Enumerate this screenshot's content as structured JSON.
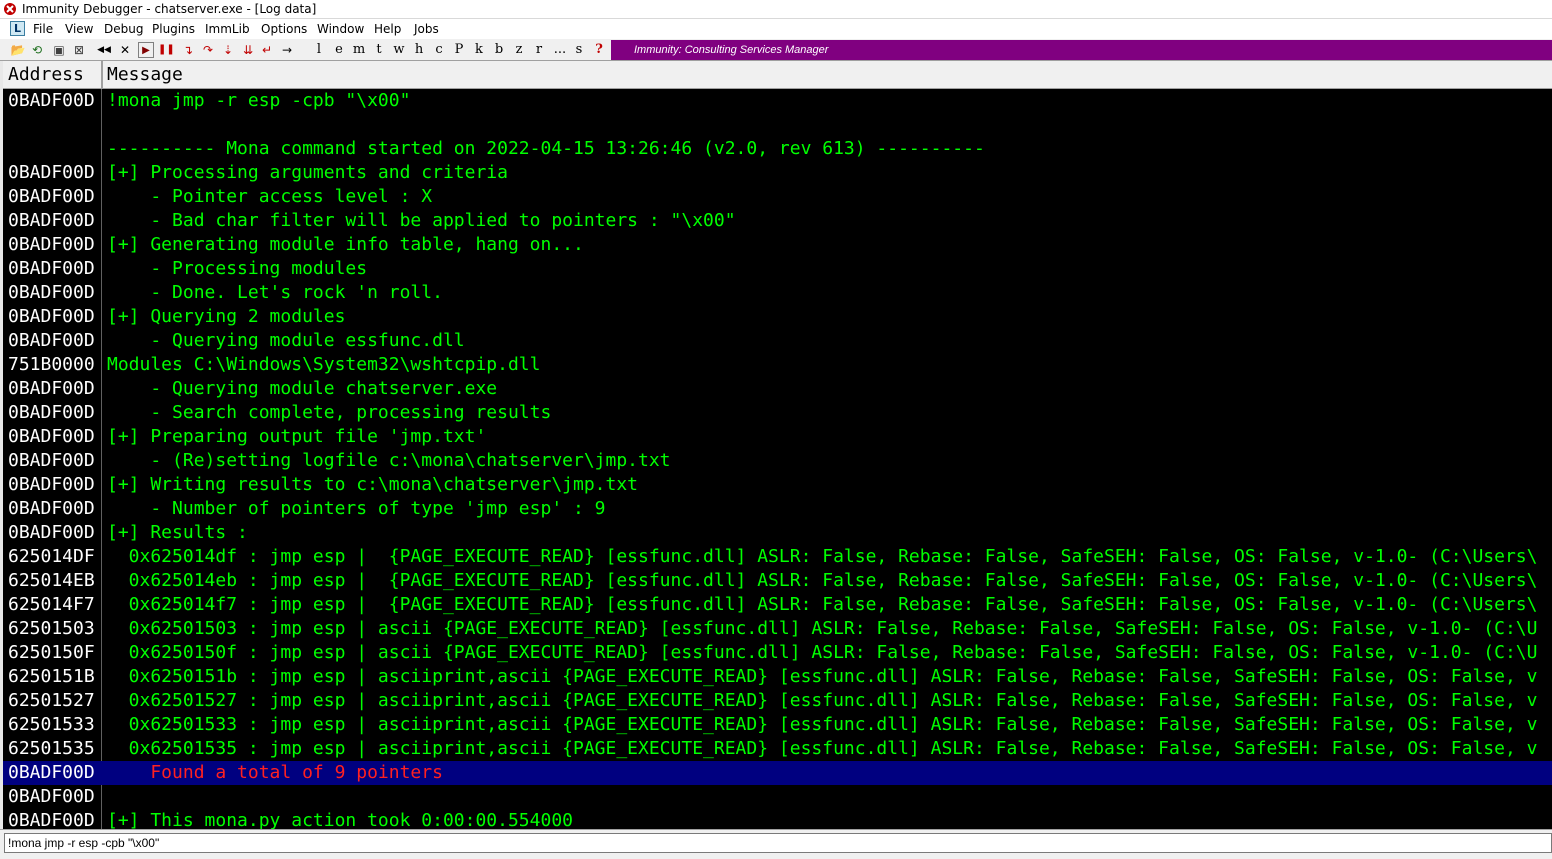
{
  "window": {
    "title": "Immunity Debugger - chatserver.exe - [Log data]"
  },
  "menu": [
    {
      "label": "File"
    },
    {
      "label": "View"
    },
    {
      "label": "Debug"
    },
    {
      "label": "Plugins"
    },
    {
      "label": "ImmLib"
    },
    {
      "label": "Options"
    },
    {
      "label": "Window"
    },
    {
      "label": "Help"
    },
    {
      "label": "Jobs"
    }
  ],
  "menu_icon_letter": "L",
  "toolbar": {
    "buttons": [
      {
        "name": "open-icon",
        "glyph": "📂"
      },
      {
        "name": "restart-icon",
        "glyph": "⟲"
      },
      {
        "name": "close-program-icon",
        "glyph": "▣"
      },
      {
        "name": "attach-icon",
        "glyph": "⊠"
      },
      {
        "name": "rewind-icon",
        "glyph": "◀◀"
      },
      {
        "name": "close-icon",
        "glyph": "✕"
      },
      {
        "name": "run-icon",
        "glyph": "▶"
      },
      {
        "name": "pause-icon",
        "glyph": "❚❚"
      },
      {
        "name": "step-into-icon",
        "glyph": "↴"
      },
      {
        "name": "step-over-icon",
        "glyph": "↷"
      },
      {
        "name": "trace-into-icon",
        "glyph": "⇣"
      },
      {
        "name": "trace-over-icon",
        "glyph": "⇊"
      },
      {
        "name": "execute-till-return-icon",
        "glyph": "↵"
      },
      {
        "name": "goto-icon",
        "glyph": "→"
      }
    ],
    "letters": [
      "l",
      "e",
      "m",
      "t",
      "w",
      "h",
      "c",
      "P",
      "k",
      "b",
      "z",
      "r",
      "...",
      "s",
      "?"
    ],
    "banner": "Immunity: Consulting Services Manager"
  },
  "log": {
    "header": {
      "address": "Address",
      "message": "Message"
    },
    "rows": [
      {
        "addr": "0BADF00D",
        "msg": "!mona jmp -r esp -cpb \"\\x00\""
      },
      {
        "addr": "",
        "msg": ""
      },
      {
        "addr": "",
        "msg": "---------- Mona command started on 2022-04-15 13:26:46 (v2.0, rev 613) ----------"
      },
      {
        "addr": "0BADF00D",
        "msg": "[+] Processing arguments and criteria"
      },
      {
        "addr": "0BADF00D",
        "msg": "    - Pointer access level : X"
      },
      {
        "addr": "0BADF00D",
        "msg": "    - Bad char filter will be applied to pointers : \"\\x00\""
      },
      {
        "addr": "0BADF00D",
        "msg": "[+] Generating module info table, hang on..."
      },
      {
        "addr": "0BADF00D",
        "msg": "    - Processing modules"
      },
      {
        "addr": "0BADF00D",
        "msg": "    - Done. Let's rock 'n roll."
      },
      {
        "addr": "0BADF00D",
        "msg": "[+] Querying 2 modules"
      },
      {
        "addr": "0BADF00D",
        "msg": "    - Querying module essfunc.dll"
      },
      {
        "addr": "751B0000",
        "msg": "Modules C:\\Windows\\System32\\wshtcpip.dll"
      },
      {
        "addr": "0BADF00D",
        "msg": "    - Querying module chatserver.exe"
      },
      {
        "addr": "0BADF00D",
        "msg": "    - Search complete, processing results"
      },
      {
        "addr": "0BADF00D",
        "msg": "[+] Preparing output file 'jmp.txt'"
      },
      {
        "addr": "0BADF00D",
        "msg": "    - (Re)setting logfile c:\\mona\\chatserver\\jmp.txt"
      },
      {
        "addr": "0BADF00D",
        "msg": "[+] Writing results to c:\\mona\\chatserver\\jmp.txt"
      },
      {
        "addr": "0BADF00D",
        "msg": "    - Number of pointers of type 'jmp esp' : 9"
      },
      {
        "addr": "0BADF00D",
        "msg": "[+] Results :"
      },
      {
        "addr": "625014DF",
        "msg": "  0x625014df : jmp esp |  {PAGE_EXECUTE_READ} [essfunc.dll] ASLR: False, Rebase: False, SafeSEH: False, OS: False, v-1.0- (C:\\Users\\"
      },
      {
        "addr": "625014EB",
        "msg": "  0x625014eb : jmp esp |  {PAGE_EXECUTE_READ} [essfunc.dll] ASLR: False, Rebase: False, SafeSEH: False, OS: False, v-1.0- (C:\\Users\\"
      },
      {
        "addr": "625014F7",
        "msg": "  0x625014f7 : jmp esp |  {PAGE_EXECUTE_READ} [essfunc.dll] ASLR: False, Rebase: False, SafeSEH: False, OS: False, v-1.0- (C:\\Users\\"
      },
      {
        "addr": "62501503",
        "msg": "  0x62501503 : jmp esp | ascii {PAGE_EXECUTE_READ} [essfunc.dll] ASLR: False, Rebase: False, SafeSEH: False, OS: False, v-1.0- (C:\\U"
      },
      {
        "addr": "6250150F",
        "msg": "  0x6250150f : jmp esp | ascii {PAGE_EXECUTE_READ} [essfunc.dll] ASLR: False, Rebase: False, SafeSEH: False, OS: False, v-1.0- (C:\\U"
      },
      {
        "addr": "6250151B",
        "msg": "  0x6250151b : jmp esp | asciiprint,ascii {PAGE_EXECUTE_READ} [essfunc.dll] ASLR: False, Rebase: False, SafeSEH: False, OS: False, v"
      },
      {
        "addr": "62501527",
        "msg": "  0x62501527 : jmp esp | asciiprint,ascii {PAGE_EXECUTE_READ} [essfunc.dll] ASLR: False, Rebase: False, SafeSEH: False, OS: False, v"
      },
      {
        "addr": "62501533",
        "msg": "  0x62501533 : jmp esp | asciiprint,ascii {PAGE_EXECUTE_READ} [essfunc.dll] ASLR: False, Rebase: False, SafeSEH: False, OS: False, v"
      },
      {
        "addr": "62501535",
        "msg": "  0x62501535 : jmp esp | asciiprint,ascii {PAGE_EXECUTE_READ} [essfunc.dll] ASLR: False, Rebase: False, SafeSEH: False, OS: False, v"
      },
      {
        "addr": "0BADF00D",
        "msg": "    Found a total of 9 pointers",
        "highlight": true
      },
      {
        "addr": "0BADF00D",
        "msg": ""
      },
      {
        "addr": "0BADF00D",
        "msg": "[+] This mona.py action took 0:00:00.554000"
      }
    ]
  },
  "command": {
    "value": "!mona jmp -r esp -cpb \"\\x00\""
  },
  "colors": {
    "log_background": "#000000",
    "log_text": "#00ff00",
    "address_text": "#ffffff",
    "highlight_background": "#000080",
    "highlight_text": "#ff2020",
    "banner_background": "#800080"
  }
}
